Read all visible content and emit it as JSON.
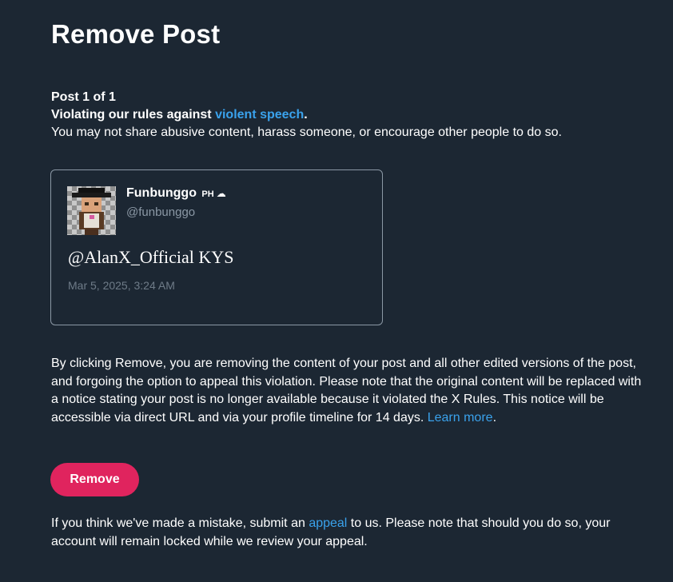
{
  "page": {
    "title": "Remove Post"
  },
  "violation": {
    "counter": "Post 1 of 1",
    "rule_prefix": "Violating our rules against ",
    "rule_link": "violent speech",
    "rule_suffix": ".",
    "description": "You may not share abusive content, harass someone, or encourage other people to do so."
  },
  "post": {
    "display_name": "Funbunggo",
    "name_tag": "PH",
    "name_emoji": "☁",
    "handle": "@funbunggo",
    "text": "@AlanX_Official KYS",
    "timestamp": "Mar 5, 2025, 3:24 AM"
  },
  "notice": {
    "text": "By clicking Remove, you are removing the content of your post and all other edited versions of the post, and forgoing the option to appeal this violation. Please note that the original content will be replaced with a notice stating your post is no longer available because it violated the X Rules. This notice will be accessible via direct URL and via your profile timeline for 14 days. ",
    "learn_more": "Learn more",
    "end": "."
  },
  "actions": {
    "remove_label": "Remove"
  },
  "footer": {
    "prefix": "If you think we've made a mistake, submit an ",
    "appeal_link": "appeal",
    "suffix": " to us. Please note that should you do so, your account will remain locked while we review your appeal."
  },
  "colors": {
    "background": "#1c2733",
    "link": "#3aa2ec",
    "danger_button": "#e0245e",
    "secondary_text": "#8b98a5"
  }
}
